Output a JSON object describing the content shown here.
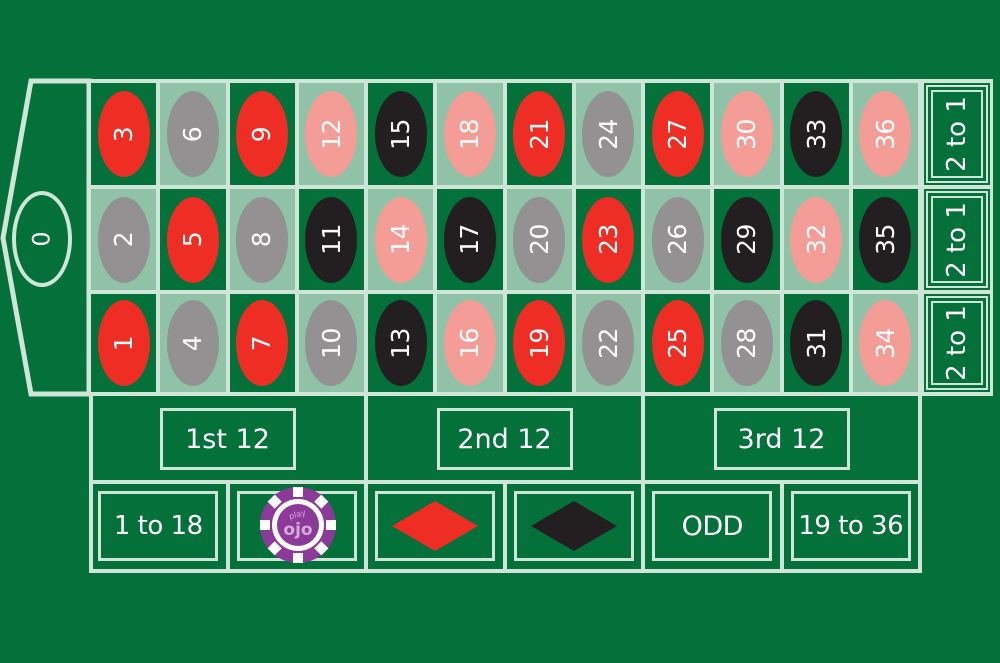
{
  "game": "Roulette table",
  "colors": {
    "felt": "#04703a",
    "light_cell": "#8fc2a6",
    "line": "#cfe5d8",
    "red": "#ee2e24",
    "black": "#231f20",
    "pink": "#f49c96",
    "grey": "#939191",
    "chip_purple": "#8c3a98"
  },
  "zero": {
    "label": "0"
  },
  "numbers": [
    {
      "n": "3",
      "color": "red"
    },
    {
      "n": "6",
      "color": "grey"
    },
    {
      "n": "9",
      "color": "red"
    },
    {
      "n": "12",
      "color": "pink"
    },
    {
      "n": "15",
      "color": "black"
    },
    {
      "n": "18",
      "color": "pink"
    },
    {
      "n": "21",
      "color": "red"
    },
    {
      "n": "24",
      "color": "grey"
    },
    {
      "n": "27",
      "color": "red"
    },
    {
      "n": "30",
      "color": "pink"
    },
    {
      "n": "33",
      "color": "black"
    },
    {
      "n": "36",
      "color": "pink"
    },
    {
      "n": "2",
      "color": "grey"
    },
    {
      "n": "5",
      "color": "red"
    },
    {
      "n": "8",
      "color": "grey"
    },
    {
      "n": "11",
      "color": "black"
    },
    {
      "n": "14",
      "color": "pink"
    },
    {
      "n": "17",
      "color": "black"
    },
    {
      "n": "20",
      "color": "grey"
    },
    {
      "n": "23",
      "color": "red"
    },
    {
      "n": "26",
      "color": "grey"
    },
    {
      "n": "29",
      "color": "black"
    },
    {
      "n": "32",
      "color": "pink"
    },
    {
      "n": "35",
      "color": "black"
    },
    {
      "n": "1",
      "color": "red"
    },
    {
      "n": "4",
      "color": "grey"
    },
    {
      "n": "7",
      "color": "red"
    },
    {
      "n": "10",
      "color": "grey"
    },
    {
      "n": "13",
      "color": "black"
    },
    {
      "n": "16",
      "color": "pink"
    },
    {
      "n": "19",
      "color": "red"
    },
    {
      "n": "22",
      "color": "grey"
    },
    {
      "n": "25",
      "color": "red"
    },
    {
      "n": "28",
      "color": "grey"
    },
    {
      "n": "31",
      "color": "black"
    },
    {
      "n": "34",
      "color": "pink"
    }
  ],
  "column_bets": [
    {
      "label": "2 to 1"
    },
    {
      "label": "2 to 1"
    },
    {
      "label": "2 to 1"
    }
  ],
  "dozens": [
    {
      "label": "1st 12"
    },
    {
      "label": "2nd 12"
    },
    {
      "label": "3rd 12"
    }
  ],
  "outside_bets": [
    {
      "label": "1 to 18",
      "type": "text"
    },
    {
      "label": "",
      "type": "even-covered-by-chip"
    },
    {
      "label": "",
      "type": "red-diamond"
    },
    {
      "label": "",
      "type": "black-diamond"
    },
    {
      "label": "ODD",
      "type": "text"
    },
    {
      "label": "19 to 36",
      "type": "text"
    }
  ],
  "chip": {
    "brand": "play ojo"
  }
}
